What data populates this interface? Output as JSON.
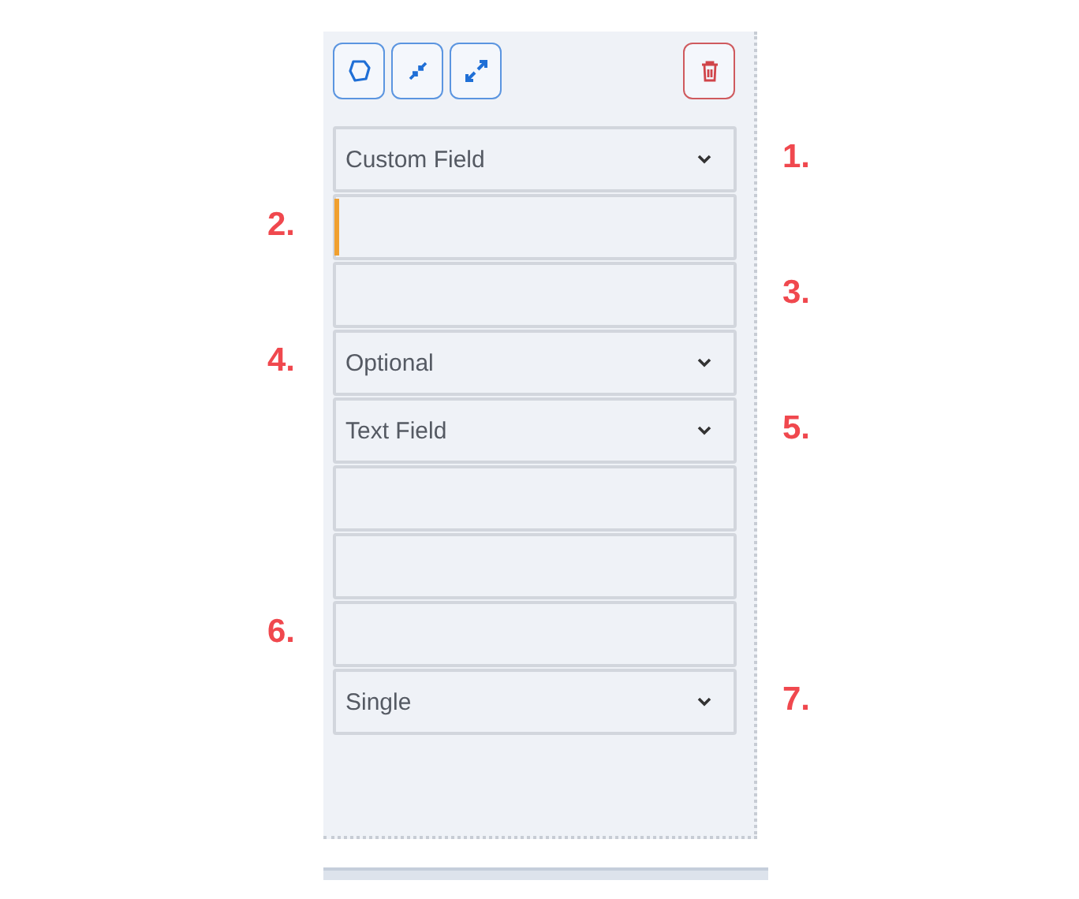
{
  "toolbar": {
    "buttons": [
      {
        "kind": "shape"
      },
      {
        "kind": "collapse"
      },
      {
        "kind": "expand"
      }
    ],
    "delete": {
      "kind": "trash"
    }
  },
  "fields": [
    {
      "kind": "select",
      "value": "Custom Field",
      "right_callout": "1."
    },
    {
      "kind": "text",
      "focused": true,
      "left_callout": "2."
    },
    {
      "kind": "text",
      "focused": false,
      "right_callout": "3."
    },
    {
      "kind": "select",
      "value": "Optional",
      "left_callout": "4."
    },
    {
      "kind": "select",
      "value": "Text Field",
      "right_callout": "5."
    },
    {
      "kind": "text",
      "focused": false
    },
    {
      "kind": "text",
      "focused": false
    },
    {
      "kind": "text",
      "focused": false,
      "left_callout": "6."
    },
    {
      "kind": "select",
      "value": "Single",
      "right_callout": "7."
    }
  ]
}
